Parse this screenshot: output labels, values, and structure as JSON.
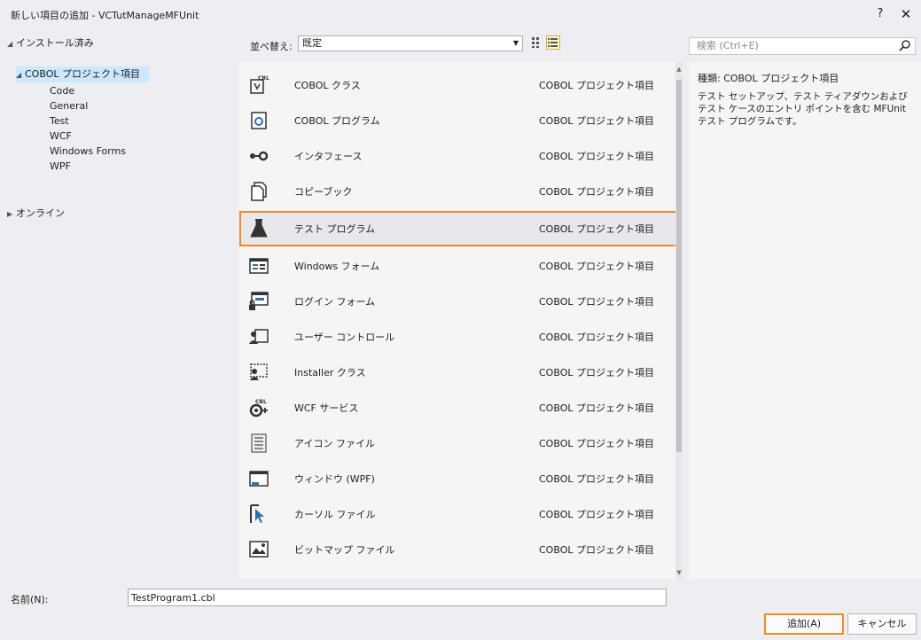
{
  "window": {
    "title": "新しい項目の追加 - VCTutManageMFUnit",
    "help_label": "?",
    "close_label": "✕"
  },
  "tree": {
    "installed": {
      "label": "インストール済み",
      "expanded": true
    },
    "project_items": {
      "label": "COBOL プロジェクト項目",
      "expanded": true,
      "children": [
        "Code",
        "General",
        "Test",
        "WCF",
        "Windows Forms",
        "WPF"
      ]
    },
    "online": {
      "label": "オンライン",
      "expanded": false
    }
  },
  "sortbar": {
    "label": "並べ替え:",
    "selected": "既定",
    "views": [
      "grid-view-icon",
      "list-view-icon"
    ]
  },
  "templates": [
    {
      "name": "COBOL クラス",
      "type": "COBOL プロジェクト項目",
      "icon": "cobol-class-icon"
    },
    {
      "name": "COBOL プログラム",
      "type": "COBOL プロジェクト項目",
      "icon": "cobol-program-icon"
    },
    {
      "name": "インタフェース",
      "type": "COBOL プロジェクト項目",
      "icon": "interface-icon"
    },
    {
      "name": "コピーブック",
      "type": "COBOL プロジェクト項目",
      "icon": "copybook-icon"
    },
    {
      "name": "テスト プログラム",
      "type": "COBOL プロジェクト項目",
      "icon": "flask-icon",
      "selected": true
    },
    {
      "name": "Windows フォーム",
      "type": "COBOL プロジェクト項目",
      "icon": "windows-form-icon"
    },
    {
      "name": "ログイン フォーム",
      "type": "COBOL プロジェクト項目",
      "icon": "login-form-icon"
    },
    {
      "name": "ユーザー コントロール",
      "type": "COBOL プロジェクト項目",
      "icon": "user-control-icon"
    },
    {
      "name": "Installer クラス",
      "type": "COBOL プロジェクト項目",
      "icon": "installer-class-icon"
    },
    {
      "name": "WCF サービス",
      "type": "COBOL プロジェクト項目",
      "icon": "wcf-service-icon"
    },
    {
      "name": "アイコン ファイル",
      "type": "COBOL プロジェクト項目",
      "icon": "icon-file-icon"
    },
    {
      "name": "ウィンドウ (WPF)",
      "type": "COBOL プロジェクト項目",
      "icon": "wpf-window-icon"
    },
    {
      "name": "カーソル ファイル",
      "type": "COBOL プロジェクト項目",
      "icon": "cursor-file-icon"
    },
    {
      "name": "ビットマップ ファイル",
      "type": "COBOL プロジェクト項目",
      "icon": "bitmap-file-icon"
    }
  ],
  "search": {
    "placeholder": "検索 (Ctrl+E)"
  },
  "detail": {
    "type_label": "種類:",
    "type_value": "COBOL プロジェクト項目",
    "description": "テスト セットアップ、テスト ティアダウンおよびテスト ケースのエントリ ポイントを含む MFUnit テスト プログラムです。"
  },
  "footer": {
    "name_label": "名前(N):",
    "name_value": "TestProgram1.cbl",
    "add_label": "追加(A)",
    "cancel_label": "キャンセル"
  },
  "colors": {
    "accent_highlight": "#f08a24",
    "tree_selection": "#cce8ff",
    "dialog_bg": "#eeeef2"
  }
}
